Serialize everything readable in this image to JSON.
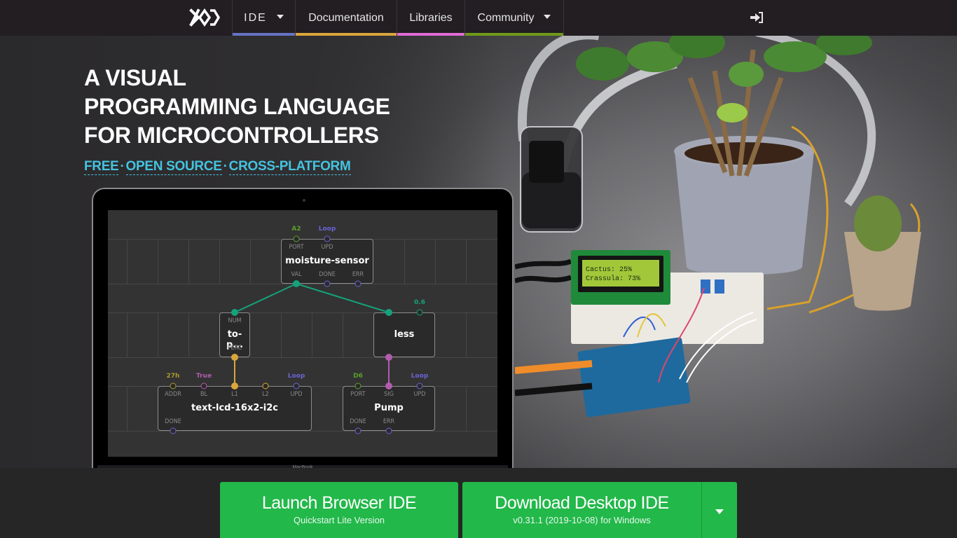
{
  "nav": {
    "logo_alt": "XOD",
    "items": [
      {
        "label": "IDE",
        "has_dropdown": true,
        "accent": "#6672c4"
      },
      {
        "label": "Documentation",
        "has_dropdown": false,
        "accent": "#d9a53b"
      },
      {
        "label": "Libraries",
        "has_dropdown": false,
        "accent": "#e06ad6"
      },
      {
        "label": "Community",
        "has_dropdown": true,
        "accent": "#6f9a1a"
      }
    ],
    "login_icon": "sign-in-icon"
  },
  "hero": {
    "headline": [
      "A VISUAL",
      "PROGRAMMING LANGUAGE",
      "FOR MICROCONTROLLERS"
    ],
    "tagline": [
      "FREE",
      "OPEN SOURCE",
      "CROSS-PLATFORM"
    ],
    "tagline_separator": "·",
    "laptop_label": "MacBook"
  },
  "patch": {
    "nodes": [
      {
        "id": "moisture-sensor",
        "title": "moisture-sensor",
        "inputs": [
          {
            "label": "PORT",
            "value": "A2",
            "color": "#5aa02c"
          },
          {
            "label": "UPD",
            "value": "Loop",
            "color": "#6a63d4"
          }
        ],
        "outputs": [
          {
            "label": "VAL",
            "color": "#14a37a"
          },
          {
            "label": "DONE",
            "color": "#6a63d4"
          },
          {
            "label": "ERR",
            "color": "#6a63d4"
          }
        ]
      },
      {
        "id": "to-percent",
        "title": "to-p...",
        "inputs": [
          {
            "label": "NUM",
            "color": "#14a37a"
          }
        ],
        "outputs": [
          {
            "label": "PERC",
            "color": "#d9a53b"
          }
        ]
      },
      {
        "id": "less",
        "title": "less",
        "inputs": [
          {
            "label": "",
            "color": "#14a37a"
          },
          {
            "label": "",
            "value": "0.6",
            "color": "#14a37a"
          }
        ],
        "outputs": [
          {
            "label": "",
            "color": "#b45bb0"
          }
        ]
      },
      {
        "id": "text-lcd",
        "title": "text-lcd-16x2-i2c",
        "inputs": [
          {
            "label": "ADDR",
            "value": "27h",
            "color": "#a89a2c"
          },
          {
            "label": "BL",
            "value": "True",
            "color": "#b45bb0"
          },
          {
            "label": "L1",
            "color": "#d9a53b"
          },
          {
            "label": "L2",
            "color": "#d9a53b"
          },
          {
            "label": "UPD",
            "value": "Loop",
            "color": "#6a63d4"
          }
        ],
        "outputs": [
          {
            "label": "DONE",
            "color": "#6a63d4"
          }
        ]
      },
      {
        "id": "pump",
        "title": "Pump",
        "inputs": [
          {
            "label": "PORT",
            "value": "D6",
            "color": "#5aa02c"
          },
          {
            "label": "SIG",
            "color": "#b45bb0"
          },
          {
            "label": "UPD",
            "value": "Loop",
            "color": "#6a63d4"
          }
        ],
        "outputs": [
          {
            "label": "DONE",
            "color": "#6a63d4"
          },
          {
            "label": "ERR",
            "color": "#6a63d4"
          }
        ]
      }
    ]
  },
  "photo": {
    "lcd_line1": "Cactus: 25%",
    "lcd_line2": "Crassula: 73%"
  },
  "cta": {
    "launch": {
      "title": "Launch Browser IDE",
      "subtitle": "Quickstart Lite Version"
    },
    "download": {
      "title": "Download Desktop IDE",
      "subtitle": "v0.31.1 (2019-10-08) for Windows"
    },
    "dropdown_icon": "caret-down-icon",
    "color": "#22b84a"
  }
}
